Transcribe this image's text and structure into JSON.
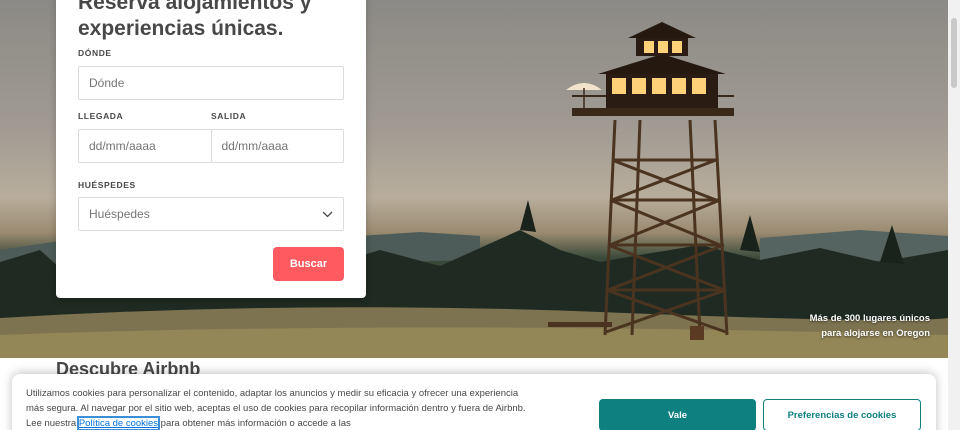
{
  "hero": {
    "caption_line1": "Más de 300 lugares únicos",
    "caption_line2": "para alojarse en Oregon"
  },
  "booking": {
    "title": "Reserva alojamientos y experiencias únicas.",
    "where_label": "DÓNDE",
    "where_placeholder": "Dónde",
    "checkin_label": "LLEGADA",
    "checkout_label": "SALIDA",
    "checkin_placeholder": "dd/mm/aaaa",
    "checkout_placeholder": "dd/mm/aaaa",
    "guests_label": "HUÉSPEDES",
    "guests_value": "Huéspedes",
    "search_button": "Buscar"
  },
  "section": {
    "discover_title": "Descubre Airbnb"
  },
  "cookie_banner": {
    "text_before_link": "Utilizamos cookies para personalizar el contenido, adaptar los anuncios y medir su eficacia y ofrecer una experiencia más segura. Al navegar por el sitio web, aceptas el uso de cookies para recopilar información dentro y fuera de Airbnb. Lee nuestra ",
    "link_text": "Política de cookies",
    "text_after_link": " para obtener más información o accede a las",
    "accept_button": "Vale",
    "preferences_button": "Preferencias de cookies"
  },
  "colors": {
    "brand_red": "#ff5a5f",
    "teal": "#0e8080"
  }
}
